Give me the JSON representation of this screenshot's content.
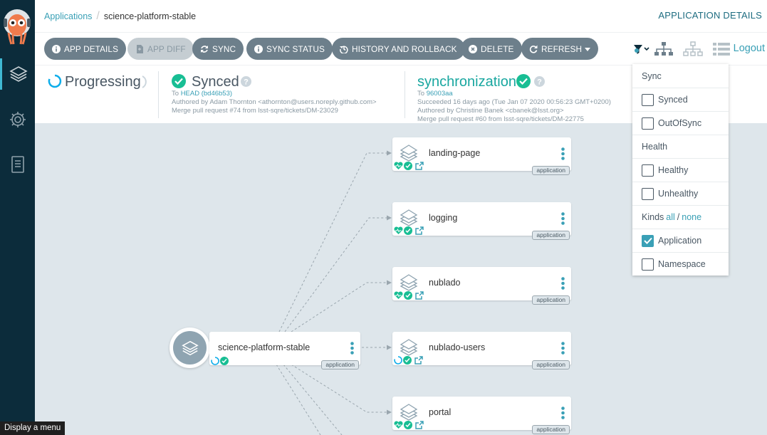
{
  "breadcrumb": {
    "parent": "Applications",
    "current": "science-platform-stable"
  },
  "header": {
    "title": "APPLICATION DETAILS"
  },
  "toolbar": {
    "app_details": "APP DETAILS",
    "app_diff": "APP DIFF",
    "sync": "SYNC",
    "sync_status": "SYNC STATUS",
    "history": "HISTORY AND ROLLBACK",
    "delete": "DELETE",
    "refresh": "REFRESH",
    "logout": "Logout"
  },
  "status": {
    "health": "Progressing",
    "sync": {
      "label": "Synced",
      "to_prefix": "To",
      "revision": "HEAD (bd46b53)",
      "author": "Authored by Adam Thornton <athornton@users.noreply.github.com>",
      "message": "Merge pull request #74 from lsst-sqre/tickets/DM-23029"
    },
    "operation": {
      "label": "synchronization",
      "to_prefix": "To",
      "revision": "96003aa",
      "time": "Succeeded 16 days ago (Tue Jan 07 2020 00:56:23 GMT+0200)",
      "author": "Authored by Christine Banek <cbanek@lsst.org>",
      "message": "Merge pull request #60 from lsst-sqre/tickets/DM-22775"
    }
  },
  "tree": {
    "root": {
      "name": "science-platform-stable",
      "kind": "application"
    },
    "children": [
      {
        "name": "landing-page",
        "kind": "application"
      },
      {
        "name": "logging",
        "kind": "application"
      },
      {
        "name": "nublado",
        "kind": "application"
      },
      {
        "name": "nublado-users",
        "kind": "application"
      },
      {
        "name": "portal",
        "kind": "application"
      }
    ]
  },
  "filter": {
    "sync_heading": "Sync",
    "synced": "Synced",
    "out_of_sync": "OutOfSync",
    "health_heading": "Health",
    "healthy": "Healthy",
    "unhealthy": "Unhealthy",
    "kinds_label": "Kinds",
    "kinds_all": "all",
    "kinds_sep": "/",
    "kinds_none": "none",
    "application": "Application",
    "application_checked": true,
    "namespace": "Namespace"
  },
  "tooltip": "Display a menu",
  "colors": {
    "accent": "#3aa0b6",
    "healthy": "#18be94",
    "sidebar": "#0c2c3b"
  }
}
